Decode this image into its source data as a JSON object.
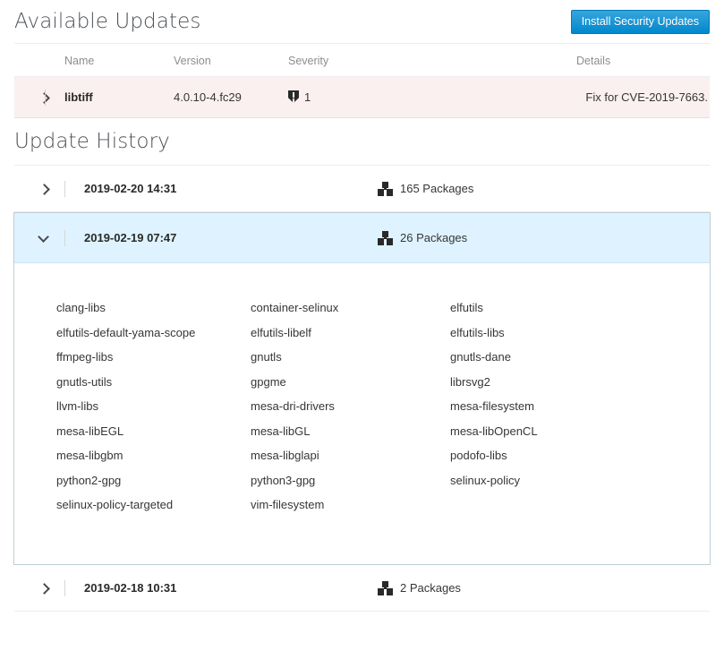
{
  "available_updates": {
    "title": "Available Updates",
    "install_button": "Install Security Updates",
    "columns": {
      "name": "Name",
      "version": "Version",
      "severity": "Severity",
      "details": "Details"
    },
    "rows": [
      {
        "name": "libtiff",
        "version": "4.0.10-4.fc29",
        "severity_count": "1",
        "severity_icon": "shield-exclamation-icon",
        "details": "Fix for CVE-2019-7663.",
        "toggle_icon": "chevron-right-icon"
      }
    ]
  },
  "update_history": {
    "title": "Update History",
    "entries": [
      {
        "date": "2019-02-20 14:31",
        "packages_label": "165 Packages",
        "packages_icon": "cubes-icon",
        "toggle_icon": "chevron-right-icon",
        "expanded": false
      },
      {
        "date": "2019-02-19 07:47",
        "packages_label": "26 Packages",
        "packages_icon": "cubes-icon",
        "toggle_icon": "chevron-down-icon",
        "expanded": true,
        "packages": [
          "clang-libs",
          "container-selinux",
          "elfutils",
          "elfutils-default-yama-scope",
          "elfutils-libelf",
          "elfutils-libs",
          "ffmpeg-libs",
          "gnutls",
          "gnutls-dane",
          "gnutls-utils",
          "gpgme",
          "librsvg2",
          "llvm-libs",
          "mesa-dri-drivers",
          "mesa-filesystem",
          "mesa-libEGL",
          "mesa-libGL",
          "mesa-libOpenCL",
          "mesa-libgbm",
          "mesa-libglapi",
          "podofo-libs",
          "python2-gpg",
          "python3-gpg",
          "selinux-policy",
          "selinux-policy-targeted",
          "vim-filesystem"
        ]
      },
      {
        "date": "2019-02-18 10:31",
        "packages_label": "2 Packages",
        "packages_icon": "cubes-icon",
        "toggle_icon": "chevron-right-icon",
        "expanded": false
      }
    ]
  },
  "colors": {
    "accent_blue": "#0088ce",
    "security_row_bg": "#faf0ef",
    "expanded_row_bg": "#def3ff",
    "heading_text": "#4d5258",
    "muted_text": "#8b8d8f"
  }
}
